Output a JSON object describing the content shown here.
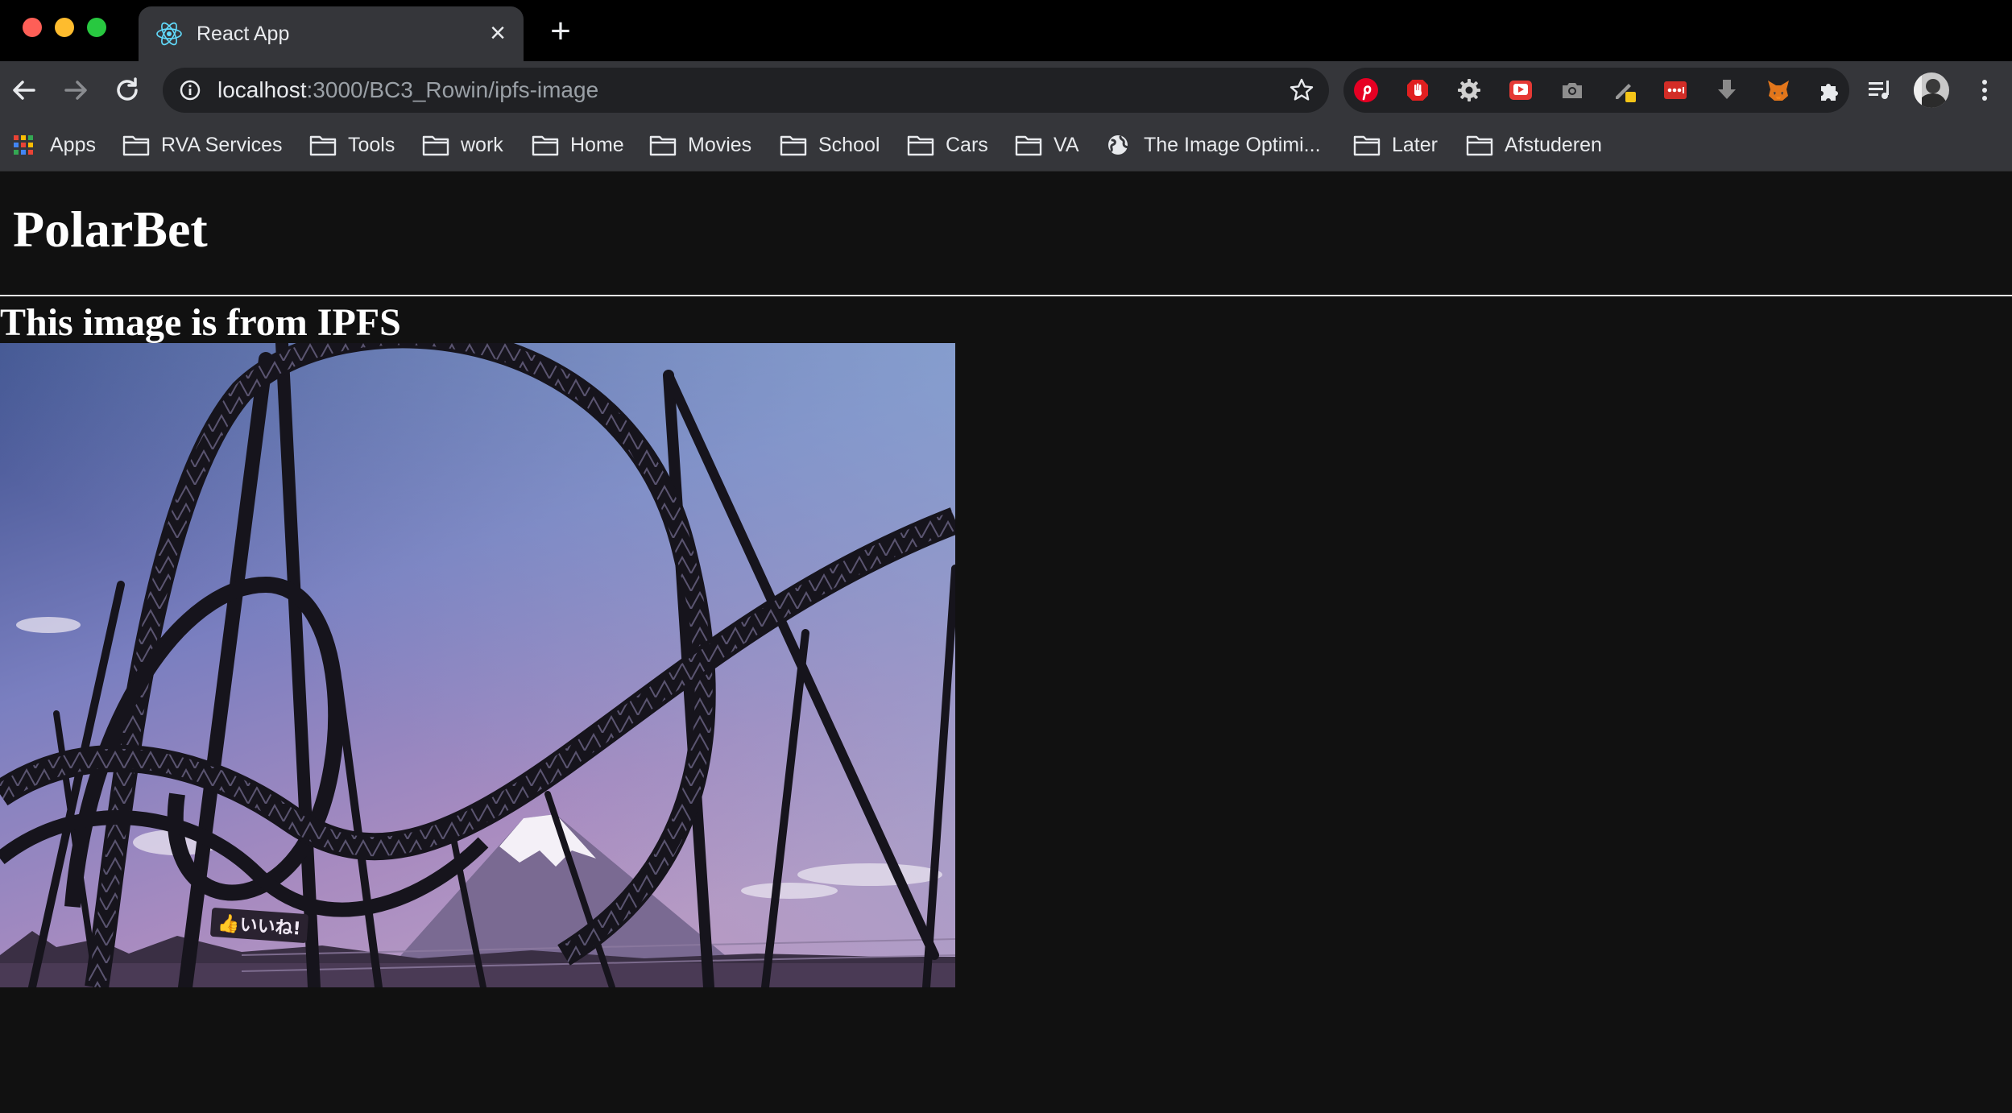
{
  "browser": {
    "tab": {
      "title": "React App",
      "favicon": "react-icon"
    },
    "url": {
      "host": "localhost",
      "rest": ":3000/BC3_Rowin/ipfs-image"
    },
    "bookmarks": [
      {
        "label": "Apps",
        "icon": "apps-grid-icon"
      },
      {
        "label": "RVA Services",
        "icon": "folder-icon"
      },
      {
        "label": "Tools",
        "icon": "folder-icon"
      },
      {
        "label": "work",
        "icon": "folder-icon"
      },
      {
        "label": "Home",
        "icon": "folder-icon"
      },
      {
        "label": "Movies",
        "icon": "folder-icon"
      },
      {
        "label": "School",
        "icon": "folder-icon"
      },
      {
        "label": "Cars",
        "icon": "folder-icon"
      },
      {
        "label": "VA",
        "icon": "folder-icon"
      },
      {
        "label": "The Image Optimi...",
        "icon": "globe-icon"
      },
      {
        "label": "Later",
        "icon": "folder-icon"
      },
      {
        "label": "Afstuderen",
        "icon": "folder-icon"
      }
    ],
    "extensions": [
      "pinterest-icon",
      "adblock-icon",
      "gear-icon",
      "youtube-icon",
      "camera-icon",
      "pen-icon",
      "lastpass-icon",
      "download-icon",
      "metamask-icon",
      "puzzle-icon"
    ],
    "colors": {
      "toolbar": "#35363a",
      "omnibox": "#202124",
      "tabstrip": "#000000"
    }
  },
  "page": {
    "title": "PolarBet",
    "heading": "This image is from IPFS",
    "image": {
      "subject": "roller coaster silhouette with mountain under purple sky",
      "sign_text": "👍いいね!"
    },
    "colors": {
      "background": "#111111",
      "text": "#ffffff"
    }
  }
}
